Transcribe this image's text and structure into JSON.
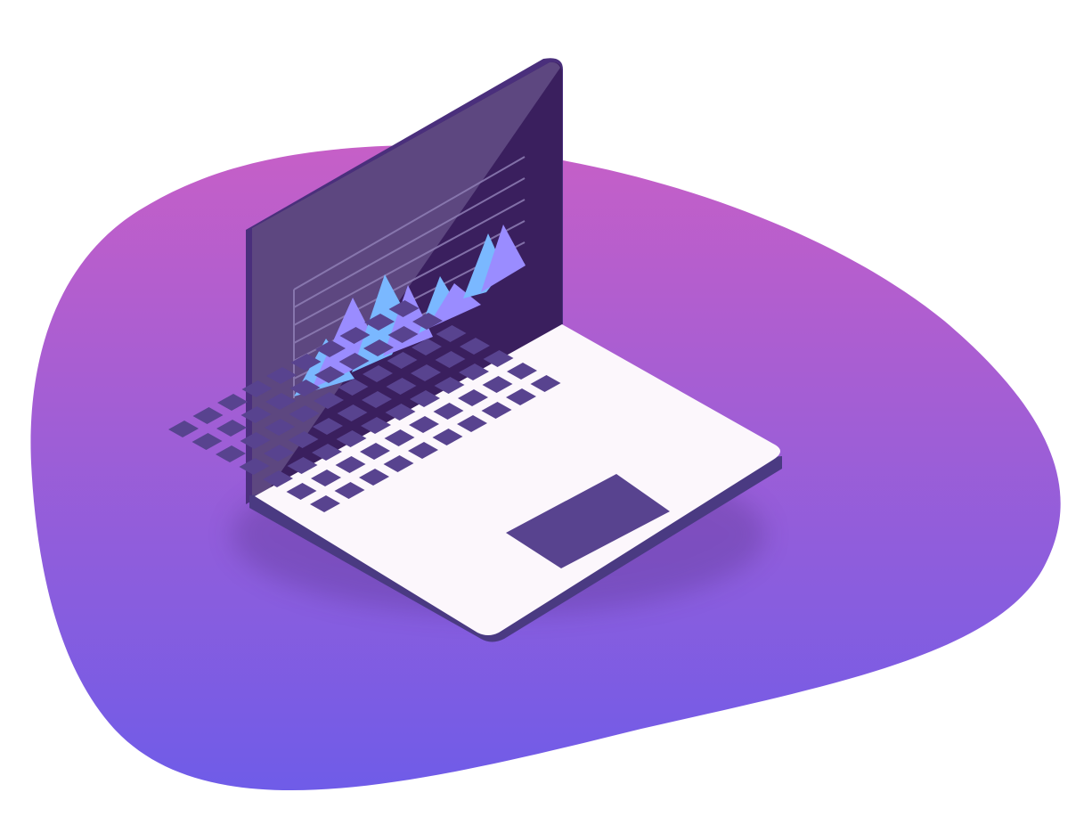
{
  "illustration": {
    "subject": "isometric-laptop-with-chart",
    "colors": {
      "blob_top": "#c65fc7",
      "blob_bottom": "#6f5ce8",
      "screen_frame": "#4a2f7c",
      "screen_dark": "#3a1f5e",
      "screen_glare": "#5f4a82",
      "keyboard_deck": "#fcf7fc",
      "deck_edge": "#4a3a82",
      "keys": "#58438f",
      "trackpad": "#58438f",
      "chart_light": "#7ab8ff",
      "chart_mid": "#9a8cff",
      "chart_lines": "#8f7fb6"
    },
    "keyboard": {
      "rows": 7,
      "keys_per_row": 10
    },
    "screen_chart": {
      "type": "mountain-area",
      "gridlines": 8,
      "peaks": 8
    }
  }
}
